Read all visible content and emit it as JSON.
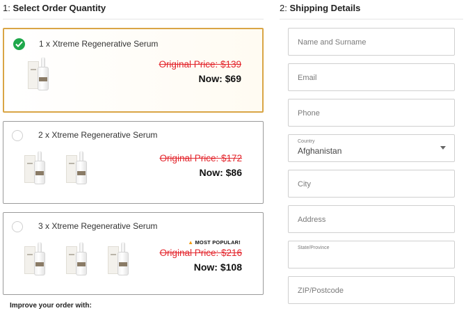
{
  "left": {
    "heading_num": "1:",
    "heading_text": "Select Order Quantity",
    "options": [
      {
        "title": "1 x Xtreme Regenerative Serum",
        "original_price": "Original Price: $139",
        "now_price": "Now: $69",
        "selected": true
      },
      {
        "title": "2 x Xtreme Regenerative Serum",
        "original_price": "Original Price: $172",
        "now_price": "Now: $86",
        "selected": false
      },
      {
        "title": "3 x Xtreme Regenerative Serum",
        "original_price": "Original Price: $216",
        "now_price": "Now: $108",
        "badge": "MOST POPULAR!",
        "selected": false
      }
    ],
    "improve_text": "Improve your order with:"
  },
  "right": {
    "heading_num": "2:",
    "heading_text": "Shipping Details",
    "fields": {
      "name": {
        "placeholder": "Name and Surname"
      },
      "email": {
        "placeholder": "Email"
      },
      "phone": {
        "placeholder": "Phone"
      },
      "country": {
        "label": "Country",
        "value": "Afghanistan"
      },
      "city": {
        "placeholder": "City"
      },
      "address": {
        "placeholder": "Address"
      },
      "state": {
        "label": "State/Province"
      },
      "zip": {
        "placeholder": "ZIP/Postcode"
      }
    }
  },
  "colors": {
    "selected_border": "#d9a545",
    "check_green": "#1fa84b",
    "strike_red": "#e3242b"
  },
  "icons": {
    "check": "check-icon",
    "fire": "fire-icon",
    "dropdown": "chevron-down-icon"
  }
}
